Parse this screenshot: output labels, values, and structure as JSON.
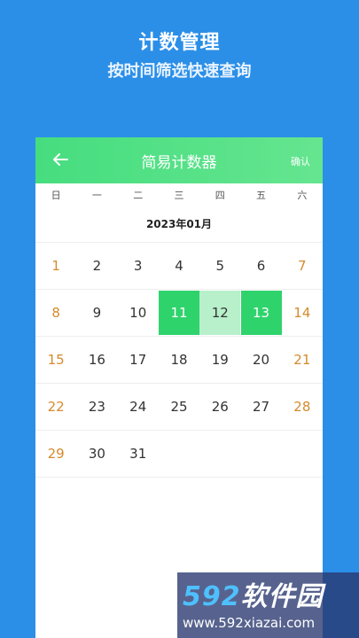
{
  "promo": {
    "title": "计数管理",
    "subtitle": "按时间筛选快速查询"
  },
  "appbar": {
    "title": "简易计数器",
    "confirm_label": "确认",
    "back_icon": "arrow-left-icon"
  },
  "weekdays": [
    "日",
    "一",
    "二",
    "三",
    "四",
    "五",
    "六"
  ],
  "calendar": {
    "month_label": "2023年01月",
    "rows": [
      [
        "1",
        "2",
        "3",
        "4",
        "5",
        "6",
        "7"
      ],
      [
        "8",
        "9",
        "10",
        "11",
        "12",
        "13",
        "14"
      ],
      [
        "15",
        "16",
        "17",
        "18",
        "19",
        "20",
        "21"
      ],
      [
        "22",
        "23",
        "24",
        "25",
        "26",
        "27",
        "28"
      ],
      [
        "29",
        "30",
        "31",
        "",
        "",
        "",
        ""
      ]
    ],
    "selection": {
      "start": "11",
      "end": "13"
    },
    "colors": {
      "accent": "#2fd36c",
      "range": "#b7f0cb",
      "weekend": "#d58a2c"
    }
  },
  "watermark": {
    "brand_num": "592",
    "brand_text": "软件园",
    "url": "www.592xiazai.com"
  }
}
